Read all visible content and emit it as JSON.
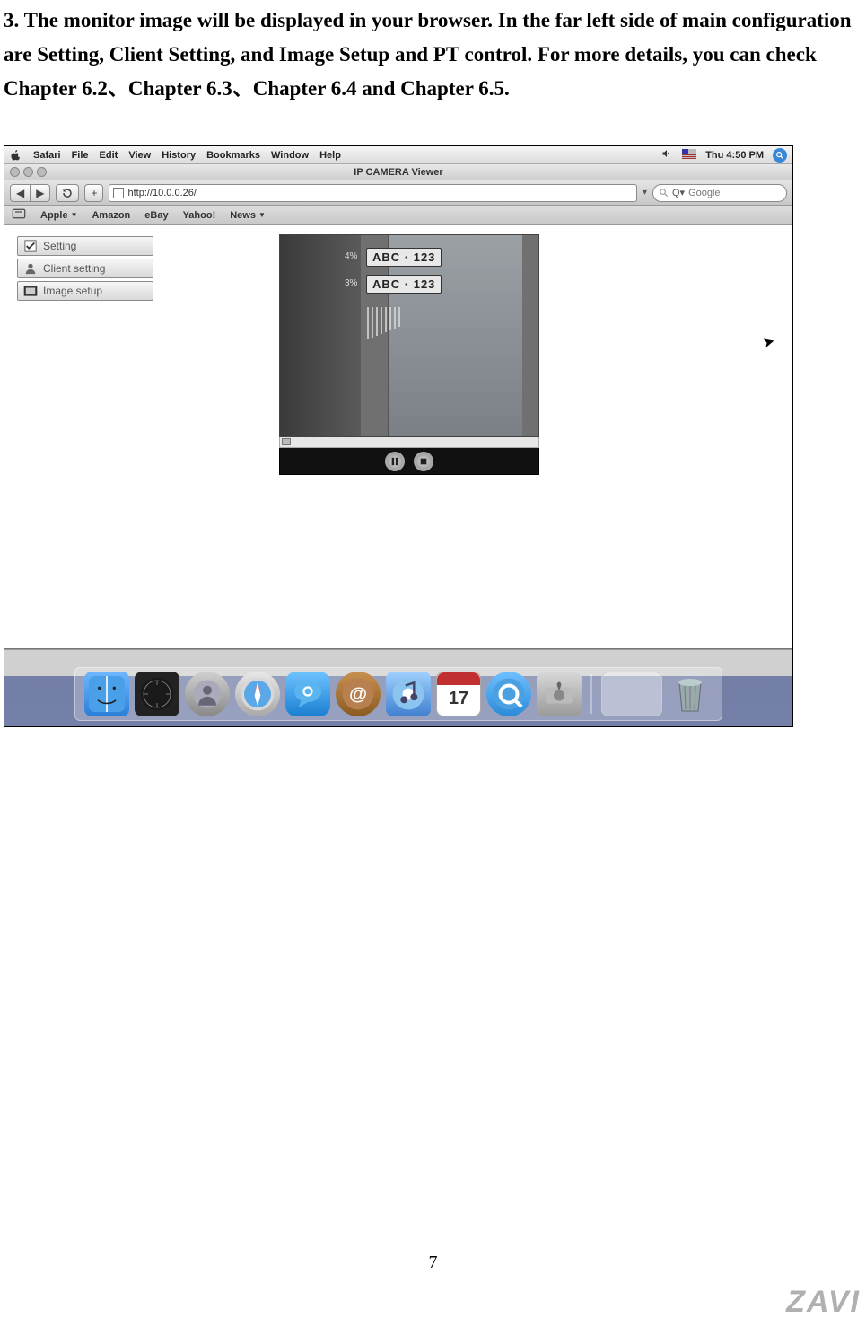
{
  "instruction_text": "3. The monitor image will be displayed in your browser. In the far left side of main configuration are Setting, Client Setting, and Image Setup and PT control. For more details, you can check Chapter 6.2、Chapter 6.3、Chapter 6.4 and Chapter 6.5.",
  "menubar": {
    "app": "Safari",
    "items": [
      "File",
      "Edit",
      "View",
      "History",
      "Bookmarks",
      "Window",
      "Help"
    ],
    "clock": "Thu 4:50 PM"
  },
  "window_title": "IP CAMERA Viewer",
  "toolbar": {
    "url": "http://10.0.0.26/",
    "search_placeholder": "Google"
  },
  "bookmarks": [
    "Apple",
    "Amazon",
    "eBay",
    "Yahoo!",
    "News"
  ],
  "sidebar": {
    "items": [
      {
        "label": "Setting"
      },
      {
        "label": "Client setting"
      },
      {
        "label": "Image setup"
      }
    ]
  },
  "video": {
    "plate1": "ABC · 123",
    "plate2": "ABC · 123",
    "pct1": "4%",
    "pct2": "3%"
  },
  "dock": {
    "calendar_day": "17"
  },
  "page_number": "7",
  "brand": "ZAVI"
}
